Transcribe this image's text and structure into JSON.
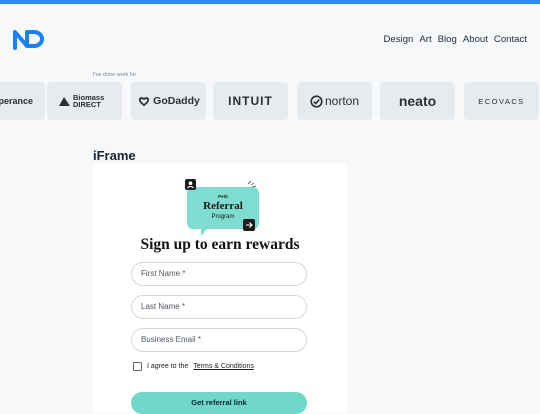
{
  "header": {
    "nav": [
      "Design",
      "Art",
      "Blog",
      "About",
      "Contact"
    ]
  },
  "clients": {
    "caption": "I've done work for",
    "logos": [
      "perance",
      "Biomass DIRECT",
      "GoDaddy",
      "INTUIT",
      "norton",
      "neato",
      "ECOVACS"
    ]
  },
  "section": {
    "title": "iFrame"
  },
  "form": {
    "badge_brand": "Petit",
    "badge_line1": "Referral",
    "badge_line2": "Program",
    "title": "Sign up to earn rewards",
    "first_name_placeholder": "First Name *",
    "last_name_placeholder": "Last Name *",
    "email_placeholder": "Business Email *",
    "agree_text": "I agree to the",
    "terms_link": "Terms & Conditions",
    "submit_label": "Get referral link"
  },
  "colors": {
    "topbar": "#2e8ef0",
    "badge_bubble": "#7dddd0",
    "submit": "#6fd8c8"
  }
}
